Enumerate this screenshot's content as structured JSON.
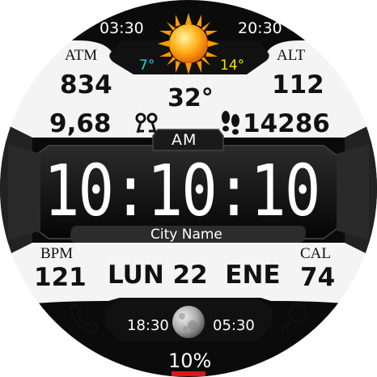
{
  "top": {
    "sunrise_time": "03:30",
    "sunset_time": "20:30",
    "temp_min": "7°",
    "temp_max": "14°",
    "temp_min_color": "#22d3e6",
    "temp_max_color": "#f2e600",
    "weather_icon": "sun-icon"
  },
  "stats": {
    "atm_label": "ATM",
    "atm_value": "834",
    "alt_label": "ALT",
    "alt_value": "112",
    "current_temp": "32°",
    "distance_value": "9,68",
    "distance_icon": "footprints-icon",
    "steps_icon": "steps-icon",
    "steps_value": "14286"
  },
  "clock": {
    "ampm": "AM",
    "time": "10:10:10",
    "city": "City Name"
  },
  "bottom": {
    "bpm_label": "BPM",
    "bpm_value": "121",
    "cal_label": "CAL",
    "cal_value": "74",
    "date": "LUN 22  ENE",
    "phone_icon": "phone-icon",
    "search_icon": "search-icon",
    "moonrise_time": "18:30",
    "moonset_time": "05:30",
    "moon_icon": "moon-icon",
    "battery_percent": "10%",
    "battery_bar_color": "#e01414"
  }
}
